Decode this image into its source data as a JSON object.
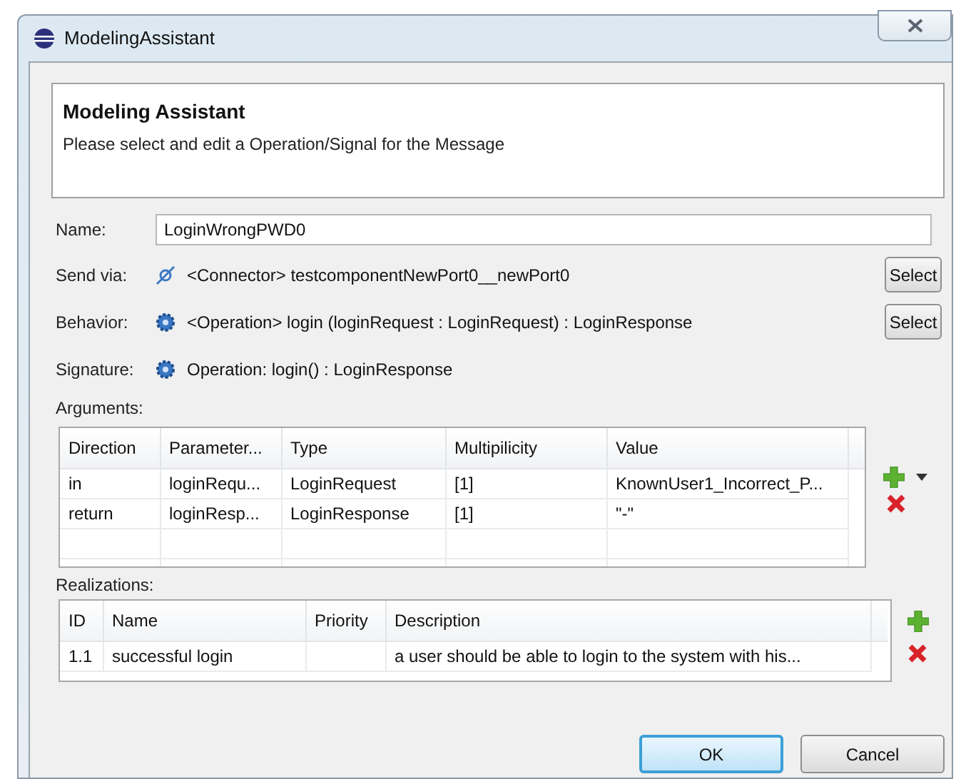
{
  "window": {
    "title": "ModelingAssistant"
  },
  "header": {
    "title": "Modeling Assistant",
    "message": "Please select and edit a Operation/Signal for the Message"
  },
  "name_field": {
    "label": "Name:",
    "value": "LoginWrongPWD0"
  },
  "properties": [
    {
      "label": "Send via:",
      "kind": "connector",
      "text": "<Connector> testcomponentNewPort0__newPort0",
      "button": "Select"
    },
    {
      "label": "Behavior:",
      "kind": "operation",
      "text": "<Operation> login (loginRequest : LoginRequest) : LoginResponse",
      "button": "Select"
    },
    {
      "label": "Signature:",
      "kind": "operation",
      "text": "Operation: login() : LoginResponse"
    }
  ],
  "arguments": {
    "label": "Arguments:",
    "columns": [
      "Direction",
      "Parameter...",
      "Type",
      "Multipilicity",
      "Value"
    ],
    "rows": [
      [
        "in",
        "loginRequ...",
        "LoginRequest",
        "[1]",
        "KnownUser1_Incorrect_P..."
      ],
      [
        "return",
        "loginResp...",
        "LoginResponse",
        "[1]",
        "\"-\""
      ]
    ]
  },
  "realizations": {
    "label": "Realizations:",
    "columns": [
      "ID",
      "Name",
      "Priority",
      "Description"
    ],
    "rows": [
      [
        "1.1",
        "successful login",
        "",
        "a user should be able to login to the system with his..."
      ]
    ]
  },
  "buttons": [
    {
      "label": "OK",
      "default": true
    },
    {
      "label": "Cancel",
      "default": false
    }
  ]
}
